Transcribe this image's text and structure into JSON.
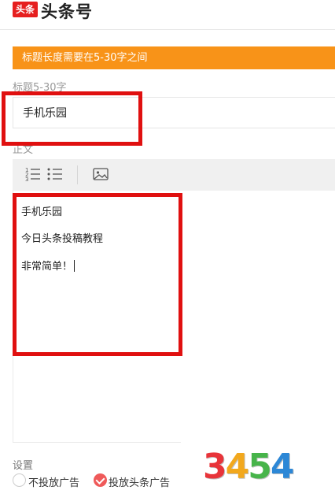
{
  "header": {
    "logo_badge": "头条",
    "logo_text": "头条号"
  },
  "notice": {
    "text": "标题长度需要在5-30字之间"
  },
  "title_section": {
    "label": "标题5-30字",
    "value": "手机乐园"
  },
  "body_section": {
    "label": "正文",
    "toolbar": {
      "icons": [
        "ordered-list-icon",
        "unordered-list-icon",
        "image-icon"
      ]
    },
    "lines": [
      "手机乐园",
      "今日头条投稿教程",
      "非常简单！"
    ]
  },
  "settings": {
    "label": "设置",
    "options": [
      {
        "label": "不投放广告",
        "selected": false
      },
      {
        "label": "投放头条广告",
        "selected": true
      }
    ]
  },
  "watermark": {
    "chars": [
      "3",
      "4",
      "5",
      "4"
    ],
    "colors": [
      "#e8343a",
      "#f2a81d",
      "#47b44a",
      "#2c87d6"
    ]
  },
  "colors": {
    "notice_bg": "#f89318",
    "highlight_red": "#e01010",
    "logo_red": "#e61f1f",
    "radio_checked": "#ef5a5a"
  }
}
